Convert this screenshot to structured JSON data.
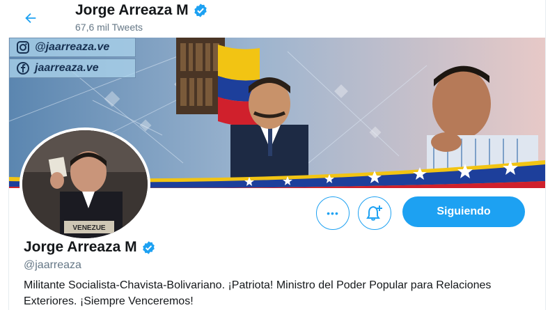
{
  "header": {
    "name": "Jorge Arreaza M",
    "tweet_count": "67,6 mil Tweets"
  },
  "banner": {
    "instagram": "@jaarreaza.ve",
    "facebook": "jaarreaza.ve"
  },
  "profile": {
    "name": "Jorge Arreaza M",
    "handle": "@jaarreaza",
    "bio": "Militante Socialista-Chavista-Bolivariano. ¡Patriota! Ministro del Poder Popular para Relaciones Exteriores. ¡Siempre Venceremos!",
    "photo_nameplate": "VENEZUE"
  },
  "actions": {
    "more_symbol": "•••",
    "follow_label": "Siguiendo"
  },
  "colors": {
    "accent": "#1da1f2",
    "text": "#14171a",
    "muted": "#657786"
  },
  "icons": {
    "back": "arrow-left-icon",
    "verified": "verified-badge-icon",
    "more": "more-icon",
    "bell": "notification-bell-icon",
    "instagram": "instagram-icon",
    "facebook": "facebook-icon"
  }
}
